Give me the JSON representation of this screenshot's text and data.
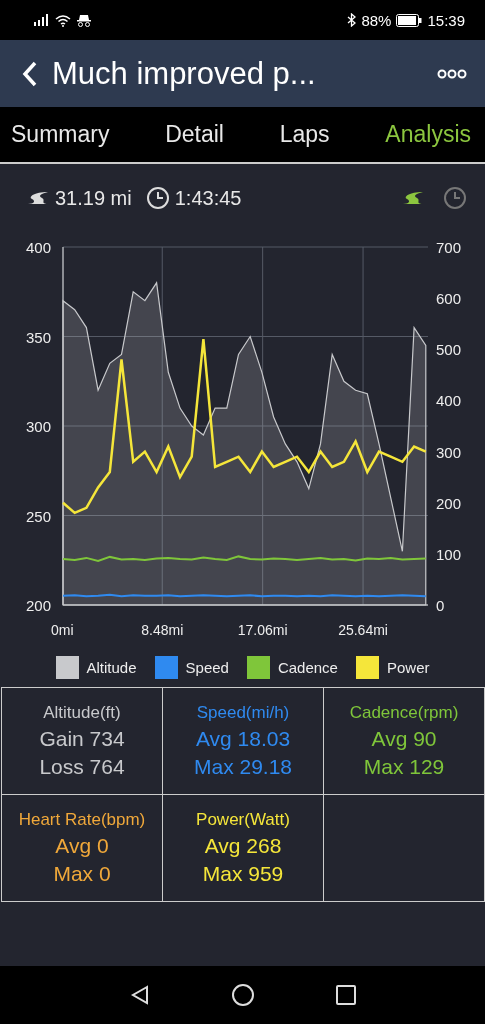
{
  "status_bar": {
    "battery": "88%",
    "time": "15:39"
  },
  "header": {
    "title": "Much improved p..."
  },
  "tabs": [
    {
      "label": "Summary",
      "selected": false
    },
    {
      "label": "Detail",
      "selected": false
    },
    {
      "label": "Laps",
      "selected": false
    },
    {
      "label": "Analysis",
      "selected": true
    }
  ],
  "summary": {
    "distance": "31.19 mi",
    "duration": "1:43:45"
  },
  "axis_toggles": [
    {
      "kind": "distance",
      "selected": true
    },
    {
      "kind": "time",
      "selected": false
    }
  ],
  "chart": {
    "chart_data": {
      "type": "line",
      "grid": true,
      "xlim": [
        0,
        31.19
      ],
      "ylim": [
        200,
        400
      ],
      "xticks": [
        {
          "value": 0,
          "label": "0mi"
        },
        {
          "value": 8.48,
          "label": "8.48mi"
        },
        {
          "value": 17.06,
          "label": "17.06mi"
        },
        {
          "value": 25.64,
          "label": "25.64mi"
        }
      ],
      "yticks": [
        200,
        250,
        300,
        350,
        400
      ],
      "y2lim": [
        0,
        700
      ],
      "y2ticks": [
        0,
        100,
        200,
        300,
        400,
        500,
        600,
        700
      ],
      "x": [
        0,
        1,
        2,
        3,
        4,
        5,
        6,
        7,
        8,
        9,
        10,
        11,
        12,
        13,
        14,
        15,
        16,
        17,
        18,
        19,
        20,
        21,
        22,
        23,
        24,
        25,
        26,
        27,
        28,
        29,
        30,
        31
      ],
      "series": [
        {
          "name": "Altitude",
          "color": "#c8c9cc",
          "type": "area",
          "values": [
            370,
            365,
            355,
            320,
            335,
            340,
            375,
            370,
            380,
            330,
            310,
            300,
            295,
            310,
            310,
            340,
            350,
            330,
            305,
            290,
            280,
            265,
            290,
            340,
            325,
            320,
            318,
            290,
            260,
            230,
            355,
            345
          ]
        },
        {
          "name": "Speed",
          "color": "#2f8af0",
          "axis": "y2",
          "values": [
            18,
            19,
            17,
            18,
            20,
            17,
            19,
            18,
            18,
            19,
            17,
            18,
            19,
            18,
            17,
            18,
            19,
            17,
            18,
            18,
            17,
            18,
            17,
            19,
            18,
            17,
            18,
            17,
            18,
            19,
            18,
            17
          ]
        },
        {
          "name": "Cadence",
          "color": "#7fc63a",
          "axis": "y2",
          "values": [
            90,
            88,
            92,
            86,
            94,
            89,
            90,
            88,
            91,
            92,
            90,
            89,
            93,
            90,
            88,
            95,
            90,
            89,
            91,
            90,
            88,
            90,
            92,
            89,
            90,
            87,
            91,
            90,
            92,
            89,
            90,
            91
          ]
        },
        {
          "name": "Power",
          "color": "#f5e63a",
          "axis": "y2",
          "values": [
            200,
            180,
            190,
            230,
            260,
            480,
            280,
            300,
            260,
            310,
            250,
            290,
            520,
            270,
            280,
            290,
            260,
            300,
            270,
            280,
            290,
            260,
            300,
            270,
            280,
            320,
            260,
            300,
            290,
            280,
            310,
            300
          ]
        }
      ]
    }
  },
  "stats": [
    {
      "title": "Altitude(ft)",
      "lines": [
        "Gain 734",
        "Loss 764"
      ],
      "color": "#c8c9cc"
    },
    {
      "title": "Speed(mi/h)",
      "lines": [
        "Avg 18.03",
        "Max 29.18"
      ],
      "color": "#2f8af0"
    },
    {
      "title": "Cadence(rpm)",
      "lines": [
        "Avg 90",
        "Max 129"
      ],
      "color": "#7fc63a"
    },
    {
      "title": "Heart Rate(bpm)",
      "lines": [
        "Avg 0",
        "Max 0"
      ],
      "color": "#f0a83a"
    },
    {
      "title": "Power(Watt)",
      "lines": [
        "Avg 268",
        "Max 959"
      ],
      "color": "#f5e63a"
    }
  ]
}
